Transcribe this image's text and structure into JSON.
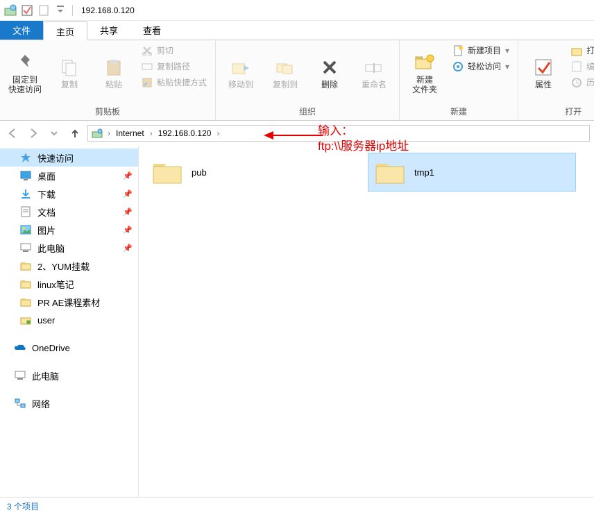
{
  "window": {
    "title": "192.168.0.120"
  },
  "tabs": {
    "file": "文件",
    "home": "主页",
    "share": "共享",
    "view": "查看"
  },
  "ribbon": {
    "clipboard": {
      "label": "剪贴板",
      "pin": "固定到\n快速访问",
      "copy": "复制",
      "paste": "粘贴",
      "cut": "剪切",
      "copy_path": "复制路径",
      "paste_shortcut": "粘贴快捷方式"
    },
    "organize": {
      "label": "组织",
      "move_to": "移动到",
      "copy_to": "复制到",
      "delete": "删除",
      "rename": "重命名"
    },
    "new": {
      "label": "新建",
      "new_folder": "新建\n文件夹",
      "new_item": "新建项目",
      "easy_access": "轻松访问"
    },
    "open": {
      "label": "打开",
      "properties": "属性",
      "open": "打开",
      "edit": "编辑",
      "history": "历史记录"
    }
  },
  "breadcrumb": {
    "seg1": "Internet",
    "seg2": "192.168.0.120"
  },
  "nav": {
    "quick_access": "快速访问",
    "desktop": "桌面",
    "downloads": "下载",
    "documents": "文档",
    "pictures": "图片",
    "this_pc_q": "此电脑",
    "yum": "2、YUM挂载",
    "linux": "linux笔记",
    "prae": "PR AE课程素材",
    "user": "user",
    "onedrive": "OneDrive",
    "this_pc": "此电脑",
    "network": "网络"
  },
  "files": {
    "pub": "pub",
    "tmp1": "tmp1"
  },
  "status": {
    "items": "3 个项目"
  },
  "annotation": {
    "line1": "输入：",
    "line2": "ftp:\\\\服务器ip地址"
  }
}
